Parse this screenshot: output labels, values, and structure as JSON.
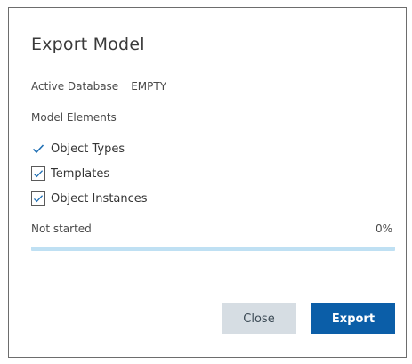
{
  "dialog": {
    "title": "Export Model",
    "active_database": {
      "label": "Active Database",
      "value": "EMPTY"
    },
    "model_elements": {
      "label": "Model Elements",
      "items": [
        {
          "label": "Object Types",
          "checked": true
        },
        {
          "label": "Templates",
          "checked": true
        },
        {
          "label": "Object Instances",
          "checked": true
        }
      ]
    },
    "progress": {
      "status": "Not started",
      "percent_text": "0%",
      "value": 0
    },
    "buttons": {
      "close_label": "Close",
      "export_label": "Export"
    }
  },
  "colors": {
    "accent": "#0b5ea8",
    "progress_track": "#bfe0f3",
    "secondary_button": "#d6dde3",
    "check_mark": "#1f6fb4"
  },
  "icons": {
    "checkmark": "check-icon"
  }
}
